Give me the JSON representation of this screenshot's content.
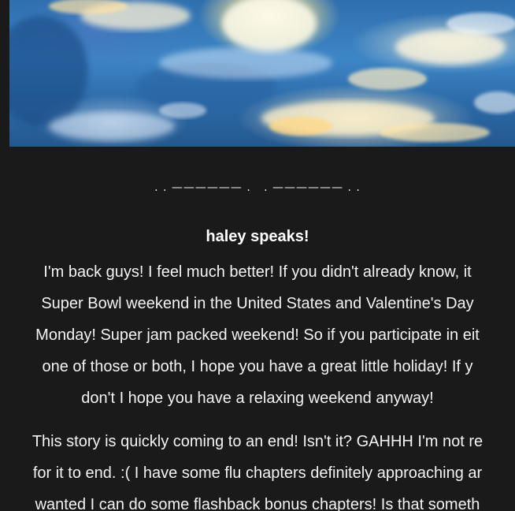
{
  "hero": {
    "image_name": "sky-clouds-image"
  },
  "divider": {
    "text": ". . —————— .   . —————— . ."
  },
  "post": {
    "heading": "haley speaks!",
    "paragraph1_lines": [
      "I'm back guys! I feel much better! If you didn't already know, it",
      "Super Bowl weekend in the United States and Valentine's Day",
      "Monday! Super jam packed weekend! So if you participate in eit",
      "one of those or both, I hope you have a great little holiday! If y",
      "don't I hope you have a relaxing weekend anyway!"
    ],
    "paragraph2_lines": [
      "This story is quickly coming to an end! Isn't it? GAHHH I'm not re",
      "for it to end. :( I have some flu  chapters definitely approaching ar",
      "wanted I can do some flashback bonus chapters! Is that someth"
    ]
  }
}
